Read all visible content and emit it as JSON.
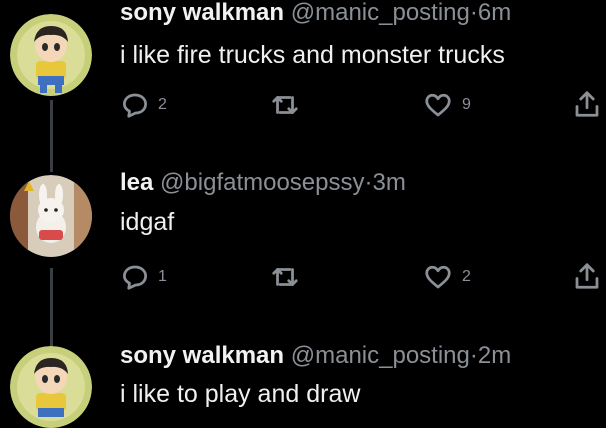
{
  "tweets": [
    {
      "name": "sony walkman",
      "handle": "@manic_posting",
      "separator": "·",
      "time": "6m",
      "text": "i like fire trucks and monster trucks",
      "replies": "2",
      "likes": "9"
    },
    {
      "name": "lea",
      "handle": "@bigfatmoosepssy",
      "separator": "·",
      "time": "3m",
      "text": "idgaf",
      "replies": "1",
      "likes": "2"
    },
    {
      "name": "sony walkman",
      "handle": "@manic_posting",
      "separator": "·",
      "time": "2m",
      "text": "i like to play and draw"
    }
  ],
  "icons": {
    "reply": "reply-icon",
    "retweet": "retweet-icon",
    "like": "heart-icon",
    "share": "share-icon"
  },
  "colors": {
    "background": "#000000",
    "text": "#e7e9ea",
    "muted": "#8b9096",
    "thread_line": "#3a3d41"
  }
}
